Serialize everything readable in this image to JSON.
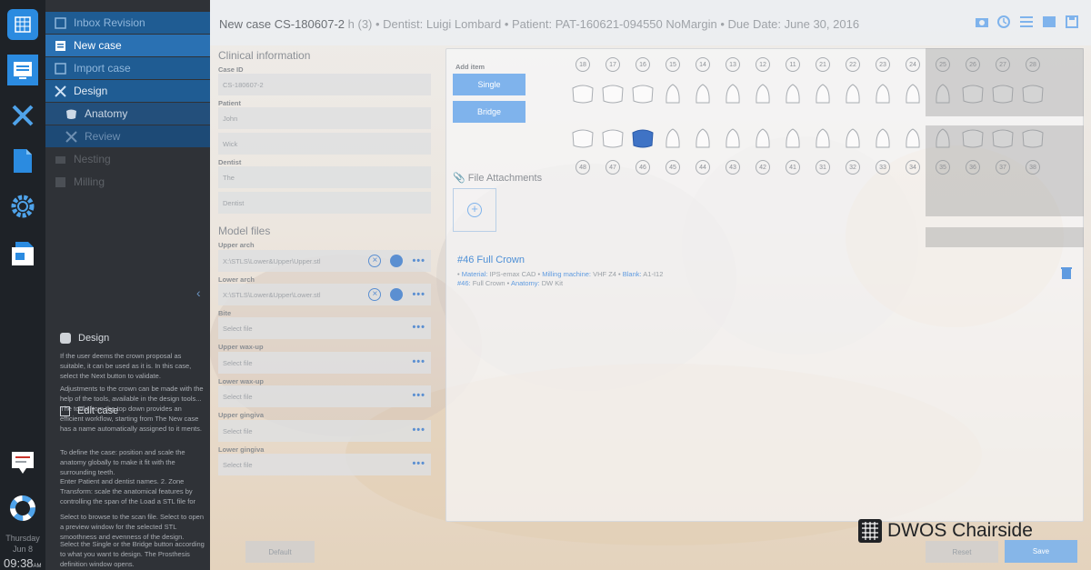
{
  "app": {
    "brand": "DWOS Chairside",
    "accent": "#2a71b3"
  },
  "header": {
    "case_label": "New case CS-180607-2",
    "details": "h (3) • Dentist: Luigi Lombard • Patient: PAT-160621-094550 NoMargin • Due Date: June 30, 2016",
    "icons": [
      "camera-icon",
      "history-icon",
      "list-icon",
      "flag-icon",
      "save-icon"
    ]
  },
  "rail": {
    "day": "Thursday",
    "date": "Jun 8",
    "time": "09:38",
    "time_suffix": "AM"
  },
  "nav": {
    "items": [
      {
        "label": "Inbox Revision",
        "icon": "inbox-icon"
      },
      {
        "label": "New case",
        "icon": "new-case-icon"
      },
      {
        "label": "Import case",
        "icon": "import-icon"
      },
      {
        "label": "Design",
        "icon": "design-icon"
      },
      {
        "label": "Anatomy",
        "icon": "anatomy-icon"
      },
      {
        "label": "Review",
        "icon": "review-icon"
      },
      {
        "label": "Nesting",
        "icon": "nesting-icon"
      },
      {
        "label": "Milling",
        "icon": "milling-icon"
      }
    ]
  },
  "help": {
    "title": "Design",
    "paragraphs": [
      "If the user deems the crown proposal as suitable, it can be used as it is. In this case, select the Next button to validate.",
      "Adjustments to the crown can be made with the help of the tools, available in the design tools... The tools from the top down provides an efficient workflow, starting from The New case has a name automatically assigned to it ments.",
      "To define the case: position and scale the anatomy globally to make it fit with the surrounding teeth.",
      "Enter Patient and dentist names. 2. Zone Transform: scale the anatomical features by controlling the span of the Load a STL file for the upper arch, the lower arch and the occlusion key.",
      "Select to browse to the scan file. Select to open a preview window for the selected STL smoothness and evenness of the design.",
      "Select the Single or the Bridge button according to what you want to design. The Prosthesis definition window opens."
    ],
    "sub_title": "Edit case"
  },
  "clinical": {
    "title": "Clinical information",
    "case_id_label": "Case ID",
    "case_id": "CS-180607-2",
    "patient_label": "Patient",
    "patient_first": "John",
    "patient_last": "Wick",
    "dentist_label": "Dentist",
    "dentist_first": "The",
    "dentist_last": "Dentist"
  },
  "model_files": {
    "title": "Model files",
    "files": [
      {
        "label": "Upper arch",
        "value": "X:\\STLS\\Lower&Upper\\Upper.stl",
        "loaded": true
      },
      {
        "label": "Lower arch",
        "value": "X:\\STLS\\Lower&Upper\\Lower.stl",
        "loaded": true
      },
      {
        "label": "Bite",
        "value": "Select file",
        "loaded": false
      },
      {
        "label": "Upper wax-up",
        "value": "Select file",
        "loaded": false
      },
      {
        "label": "Lower wax-up",
        "value": "Select file",
        "loaded": false
      },
      {
        "label": "Upper gingiva",
        "value": "Select file",
        "loaded": false
      },
      {
        "label": "Lower gingiva",
        "value": "Select file",
        "loaded": false
      }
    ]
  },
  "prosthesis": {
    "add_item_label": "Add item",
    "single_label": "Single",
    "bridge_label": "Bridge",
    "attachments_label": "File Attachments",
    "upper_teeth": [
      "18",
      "17",
      "16",
      "15",
      "14",
      "13",
      "12",
      "11",
      "21",
      "22",
      "23",
      "24",
      "25",
      "26",
      "27",
      "28"
    ],
    "lower_teeth": [
      "48",
      "47",
      "46",
      "45",
      "44",
      "43",
      "42",
      "41",
      "31",
      "32",
      "33",
      "34",
      "35",
      "36",
      "37",
      "38"
    ],
    "selected_tooth": "46",
    "item_title": "#46 Full Crown",
    "item_line1": {
      "material_k": "Material:",
      "material": "IPS-emax CAD",
      "machine_k": "Milling machine:",
      "machine": "VHF Z4",
      "blank_k": "Blank:",
      "blank": "A1-I12"
    },
    "item_line2": {
      "tooth_k": "#46:",
      "tooth": "Full Crown",
      "anatomy_k": "Anatomy:",
      "anatomy": "DW Kit"
    }
  },
  "footer": {
    "default_label": "Default",
    "reset_label": "Reset",
    "save_label": "Save"
  }
}
